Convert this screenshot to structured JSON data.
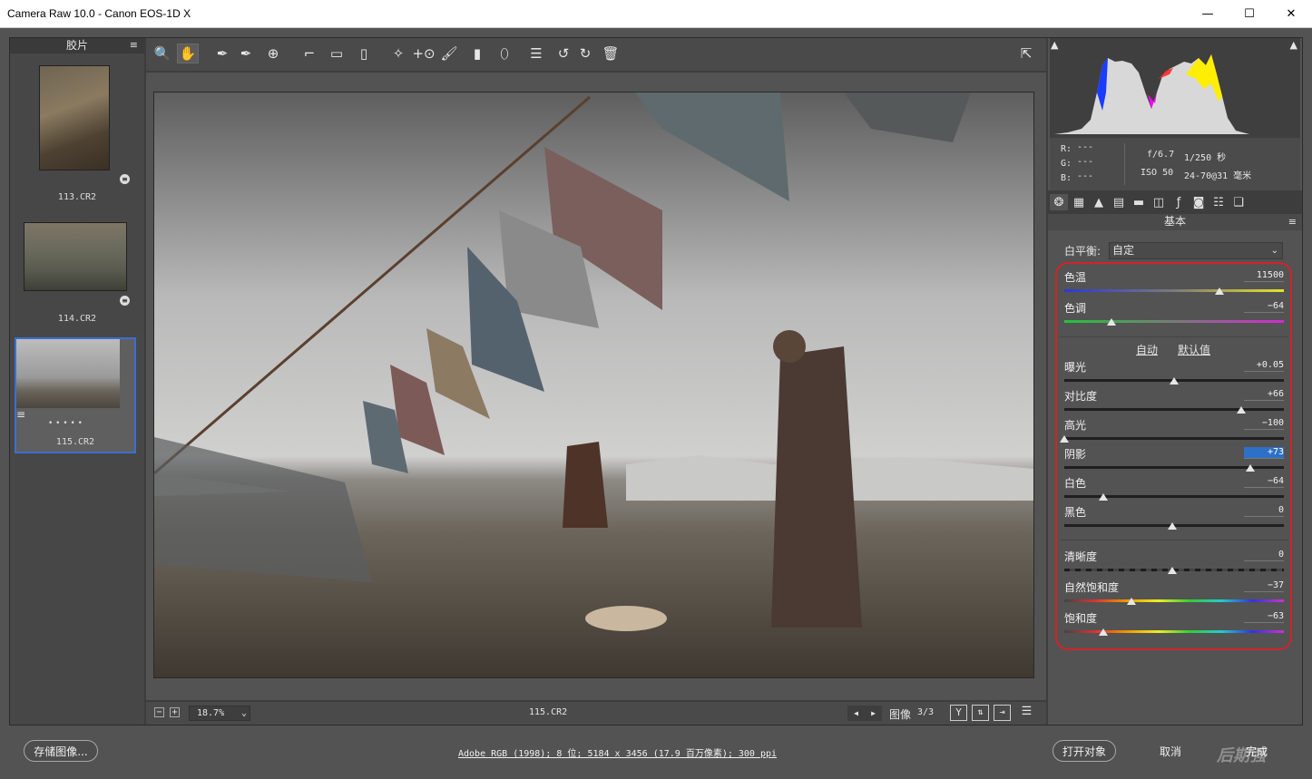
{
  "window": {
    "title": "Camera Raw 10.0 -  Canon EOS-1D X",
    "minimize": "—",
    "maximize": "☐",
    "close": "✕"
  },
  "filmstrip": {
    "title": "胶片",
    "menu_icon": "≡",
    "items": [
      {
        "label": "113.CR2",
        "selected": false
      },
      {
        "label": "114.CR2",
        "selected": false
      },
      {
        "label": "115.CR2",
        "selected": true,
        "rating": "• • • • •"
      }
    ]
  },
  "toolbar": {
    "tools": [
      "zoom-tool",
      "hand-tool",
      "white-balance-tool",
      "color-sampler-tool",
      "targeted-adjustment-tool",
      "crop-tool",
      "straighten-tool",
      "transform-tool",
      "spot-removal-tool",
      "red-eye-tool",
      "adjustment-brush-tool",
      "graduated-filter-tool",
      "radial-filter-tool",
      "preferences-tool",
      "rotate-left-tool",
      "rotate-right-tool",
      "trash-tool"
    ],
    "glyphs": [
      "🔍",
      "✋",
      "✒",
      "✒",
      "⊕",
      "⌐",
      "▭",
      "▯",
      "✧",
      "+⊙",
      "🖌",
      "▮",
      "⬯",
      "☰",
      "↺",
      "↻",
      "🗑"
    ],
    "fullscreen_glyph": "⇱"
  },
  "bottombar": {
    "zoom": "18.7%",
    "zoom_out": "−",
    "zoom_in": "+",
    "dropdown": "⌄",
    "filename": "115.CR2",
    "prev": "◀",
    "next": "▶",
    "image_label": "图像",
    "image_count": "3/3",
    "y_button": "Y"
  },
  "histogram": {
    "colors": {
      "red": "#ff2a2a",
      "blue": "#1a3cff",
      "yellow": "#ffee00",
      "white": "#d8d8d8",
      "magenta": "#ff00ff",
      "cyan": "#00e5ff"
    }
  },
  "info": {
    "r_label": "R:",
    "g_label": "G:",
    "b_label": "B:",
    "r_val": "---",
    "g_val": "---",
    "b_val": "---",
    "aperture": "f/6.7",
    "shutter": "1/250 秒",
    "iso": "ISO 50",
    "lens": "24-70@31 毫米"
  },
  "panel": {
    "title": "基本",
    "wb_label": "白平衡:",
    "wb_value": "自定",
    "auto": "自动",
    "default": "默认值",
    "sliders": [
      {
        "key": "temp",
        "label": "色温",
        "value": "11500",
        "level": 0.72,
        "track": "temp"
      },
      {
        "key": "tint",
        "label": "色调",
        "value": "−64",
        "level": 0.22,
        "track": "tint"
      },
      {
        "key": "exposure",
        "label": "曝光",
        "value": "+0.05",
        "level": 0.51,
        "track": "plain"
      },
      {
        "key": "contrast",
        "label": "对比度",
        "value": "+66",
        "level": 0.82,
        "track": "plain"
      },
      {
        "key": "highlights",
        "label": "高光",
        "value": "−100",
        "level": 0.0,
        "track": "plain"
      },
      {
        "key": "shadows",
        "label": "阴影",
        "value": "+73",
        "level": 0.86,
        "track": "plain",
        "highlighted": true
      },
      {
        "key": "whites",
        "label": "白色",
        "value": "−64",
        "level": 0.18,
        "track": "plain"
      },
      {
        "key": "blacks",
        "label": "黑色",
        "value": "0",
        "level": 0.5,
        "track": "plain"
      },
      {
        "key": "clarity",
        "label": "清晰度",
        "value": "0",
        "level": 0.5,
        "track": "clarity"
      },
      {
        "key": "vibrance",
        "label": "自然饱和度",
        "value": "−37",
        "level": 0.31,
        "track": "rainbow"
      },
      {
        "key": "saturation",
        "label": "饱和度",
        "value": "−63",
        "level": 0.18,
        "track": "rainbow"
      }
    ]
  },
  "footer": {
    "save": "存储图像...",
    "workflow": "Adobe RGB (1998); 8 位; 5184 x 3456 (17.9 百万像素); 300 ppi",
    "open": "打开对象",
    "cancel": "取消",
    "done": "完成"
  },
  "watermark": "后期强"
}
